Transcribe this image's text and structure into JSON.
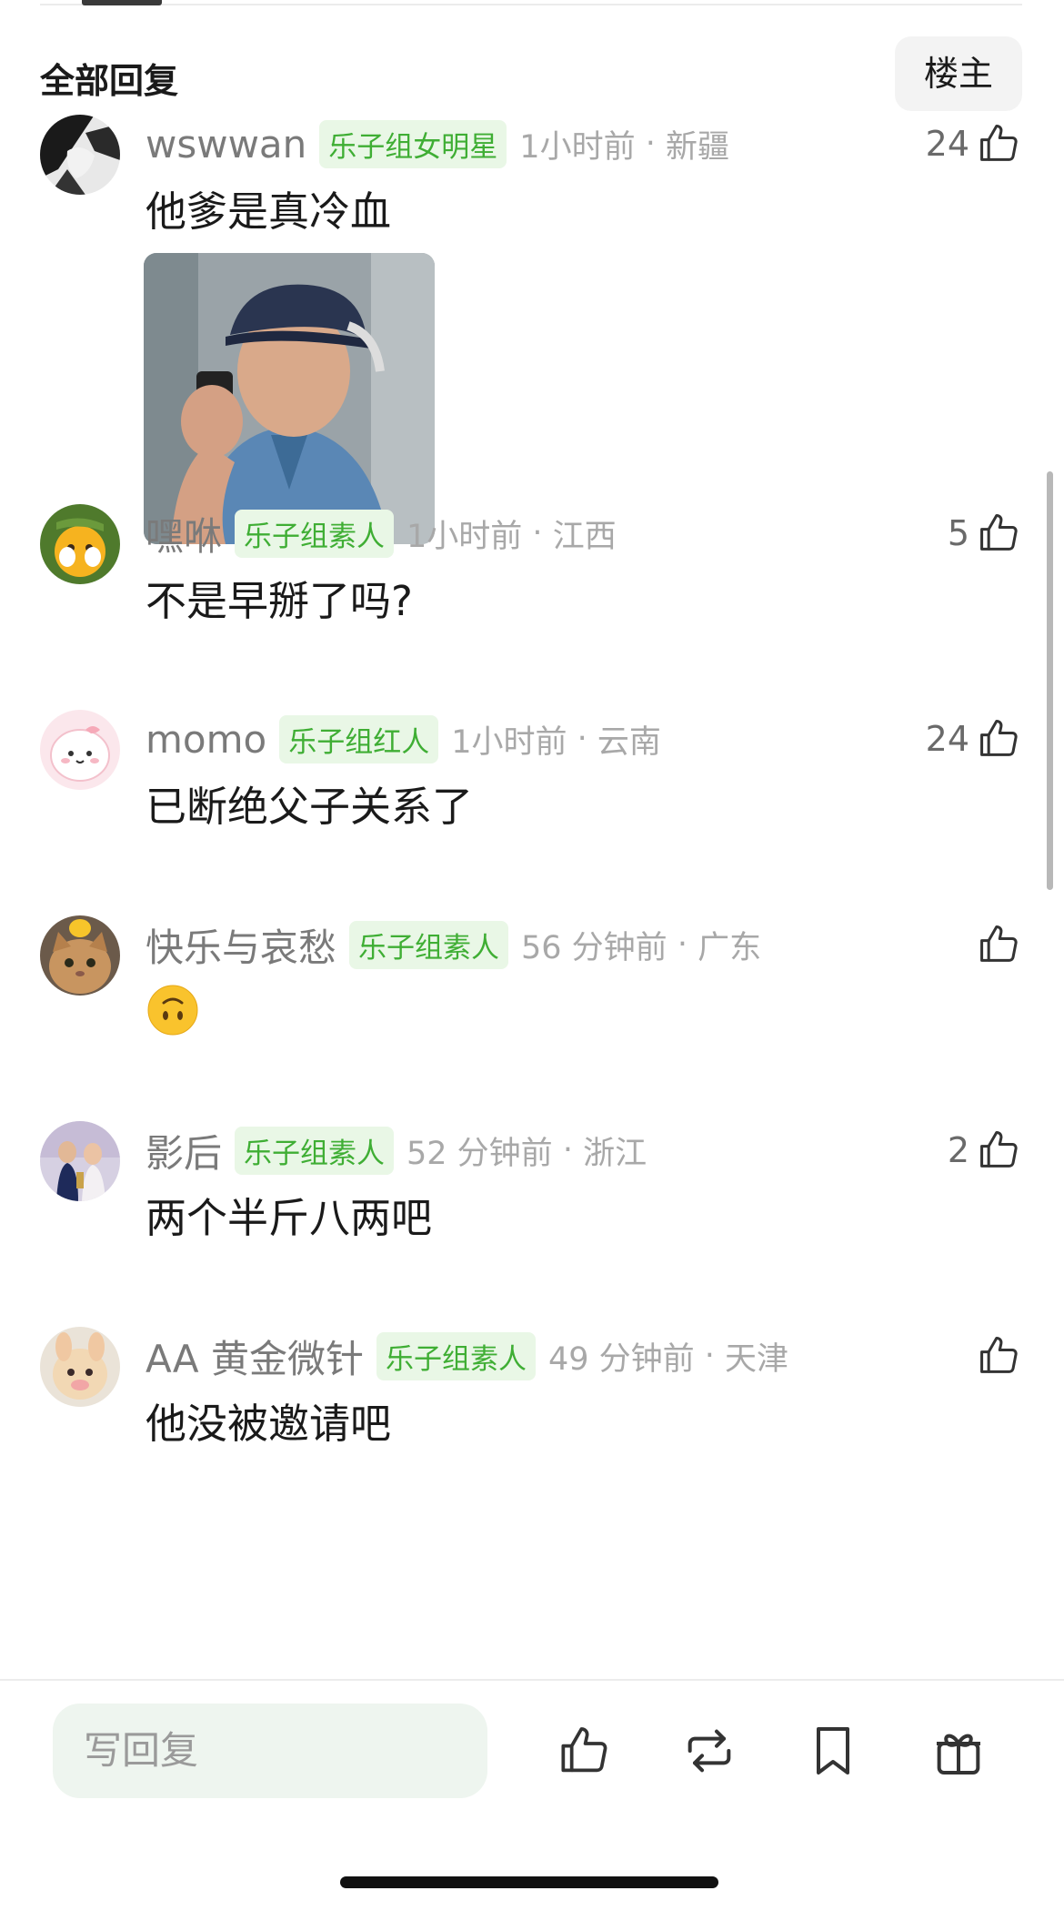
{
  "header": {
    "title": "全部回复",
    "filter_label": "楼主"
  },
  "comments": [
    {
      "username": "wswwan",
      "badge": "乐子组女明星",
      "time": "1小时前",
      "location": "新疆",
      "likes": "24",
      "text": "他爹是真冷血",
      "has_image": true
    },
    {
      "username": "嘿咻",
      "badge": "乐子组素人",
      "time": "1小时前",
      "location": "江西",
      "likes": "5",
      "text": "不是早掰了吗?"
    },
    {
      "username": "momo",
      "badge": "乐子组红人",
      "time": "1小时前",
      "location": "云南",
      "likes": "24",
      "text": "已断绝父子关系了"
    },
    {
      "username": "快乐与哀愁",
      "badge": "乐子组素人",
      "time": "56 分钟前",
      "location": "广东",
      "likes": "",
      "text": "",
      "emoji": "upside-down-face"
    },
    {
      "username": "影后",
      "badge": "乐子组素人",
      "time": "52 分钟前",
      "location": "浙江",
      "likes": "2",
      "text": "两个半斤八两吧"
    },
    {
      "username": "AA 黄金微针",
      "badge": "乐子组素人",
      "time": "49 分钟前",
      "location": "天津",
      "likes": "",
      "text": "他没被邀请吧"
    }
  ],
  "bottom_bar": {
    "reply_placeholder": "写回复",
    "icons": [
      "thumbs-up-icon",
      "repost-icon",
      "bookmark-icon",
      "gift-icon"
    ]
  },
  "colors": {
    "badge_green": "#3fae34",
    "badge_bg": "#e9f7e6",
    "meta_gray": "#a8a8a8",
    "reply_bg": "#eef5ef"
  }
}
